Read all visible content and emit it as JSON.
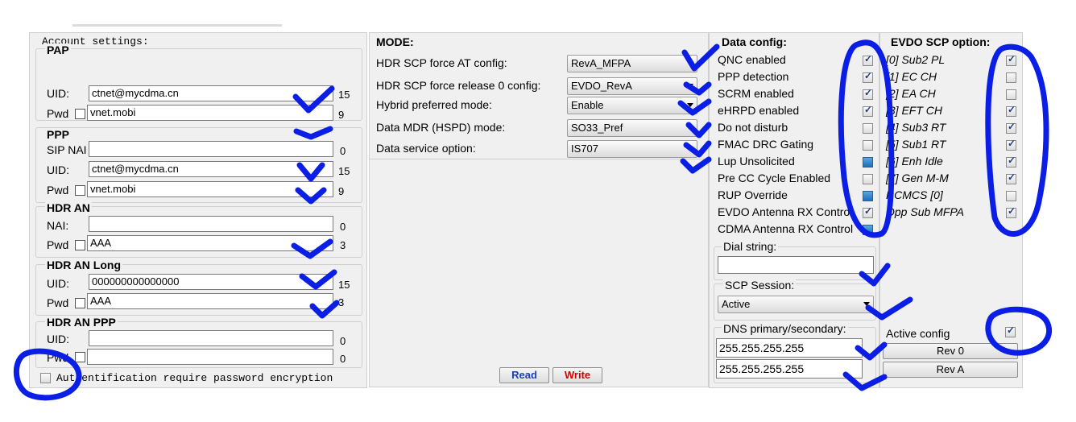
{
  "account": {
    "title": "Account settings:",
    "pap": {
      "title": "PAP",
      "uid_label": "UID:",
      "uid": "ctnet@mycdma.cn",
      "uid_len": "15",
      "pwd_label": "Pwd",
      "pwd": "vnet.mobi",
      "pwd_len": "9"
    },
    "ppp": {
      "title": "PPP",
      "sip_label": "SIP NAI",
      "sip": "",
      "sip_len": "0",
      "uid_label": "UID:",
      "uid": "ctnet@mycdma.cn",
      "uid_len": "15",
      "pwd_label": "Pwd",
      "pwd": "vnet.mobi",
      "pwd_len": "9"
    },
    "hdr_an": {
      "title": "HDR AN",
      "nai_label": "NAI:",
      "nai": "",
      "nai_len": "0",
      "pwd_label": "Pwd",
      "pwd": "AAA",
      "pwd_len": "3"
    },
    "hdr_an_long": {
      "title": "HDR AN Long",
      "uid_label": "UID:",
      "uid": "000000000000000",
      "uid_len": "15",
      "pwd_label": "Pwd",
      "pwd": "AAA",
      "pwd_len": "3"
    },
    "hdr_an_ppp": {
      "title": "HDR AN PPP",
      "uid_label": "UID:",
      "uid": "",
      "uid_len": "0",
      "pwd_label": "Pwd",
      "pwd": "",
      "pwd_len": "0"
    },
    "auth_label": "Authentification require password encryption"
  },
  "mode": {
    "title": "MODE:",
    "rows": [
      {
        "label": "HDR SCP force AT config:",
        "value": "RevA_MFPA"
      },
      {
        "label": "HDR SCP force release 0 config:",
        "value": "EVDO_RevA"
      },
      {
        "label": "Hybrid preferred mode:",
        "value": "Enable"
      },
      {
        "label": "Data MDR (HSPD) mode:",
        "value": "SO33_Pref"
      },
      {
        "label": "Data service option:",
        "value": "IS707"
      }
    ],
    "read_label": "Read",
    "write_label": "Write"
  },
  "data_config": {
    "title": "Data config:",
    "items": [
      {
        "label": "QNC enabled",
        "state": "checked"
      },
      {
        "label": "PPP detection",
        "state": "checked"
      },
      {
        "label": "SCRM enabled",
        "state": "checked"
      },
      {
        "label": "eHRPD enabled",
        "state": "checked"
      },
      {
        "label": "Do not disturb",
        "state": "unchecked"
      },
      {
        "label": "FMAC DRC Gating",
        "state": "unchecked"
      },
      {
        "label": "Lup Unsolicited",
        "state": "filled"
      },
      {
        "label": "Pre CC Cycle Enabled",
        "state": "unchecked"
      },
      {
        "label": "RUP Override",
        "state": "filled"
      },
      {
        "label": "EVDO Antenna RX Control",
        "state": "checked"
      },
      {
        "label": "CDMA Antenna RX Control",
        "state": "filled"
      }
    ],
    "dial_title": "Dial string:",
    "dial_value": "",
    "scp_title": "SCP Session:",
    "scp_value": "Active",
    "dns_title": "DNS primary/secondary:",
    "dns_primary": "255.255.255.255",
    "dns_secondary": "255.255.255.255"
  },
  "evdo": {
    "title": "EVDO SCP option:",
    "items": [
      {
        "label": "[0] Sub2 PL",
        "state": "checked"
      },
      {
        "label": "[1] EC CH",
        "state": "unchecked"
      },
      {
        "label": "[2] EA CH",
        "state": "unchecked"
      },
      {
        "label": "[3] EFT CH",
        "state": "checked"
      },
      {
        "label": "[4] Sub3 RT",
        "state": "checked"
      },
      {
        "label": "[5] Sub1 RT",
        "state": "checked"
      },
      {
        "label": "[6] Enh Idle",
        "state": "checked"
      },
      {
        "label": "[7] Gen M-M",
        "state": "checked"
      },
      {
        "label": "RCMCS [0]",
        "state": "unchecked"
      },
      {
        "label": "Opp Sub MFPA",
        "state": "checked"
      }
    ],
    "active_config_label": "Active config",
    "active_config_state": "checked",
    "rev0_label": "Rev 0",
    "reva_label": "Rev A"
  },
  "annotation_color": "#0a1ee6"
}
